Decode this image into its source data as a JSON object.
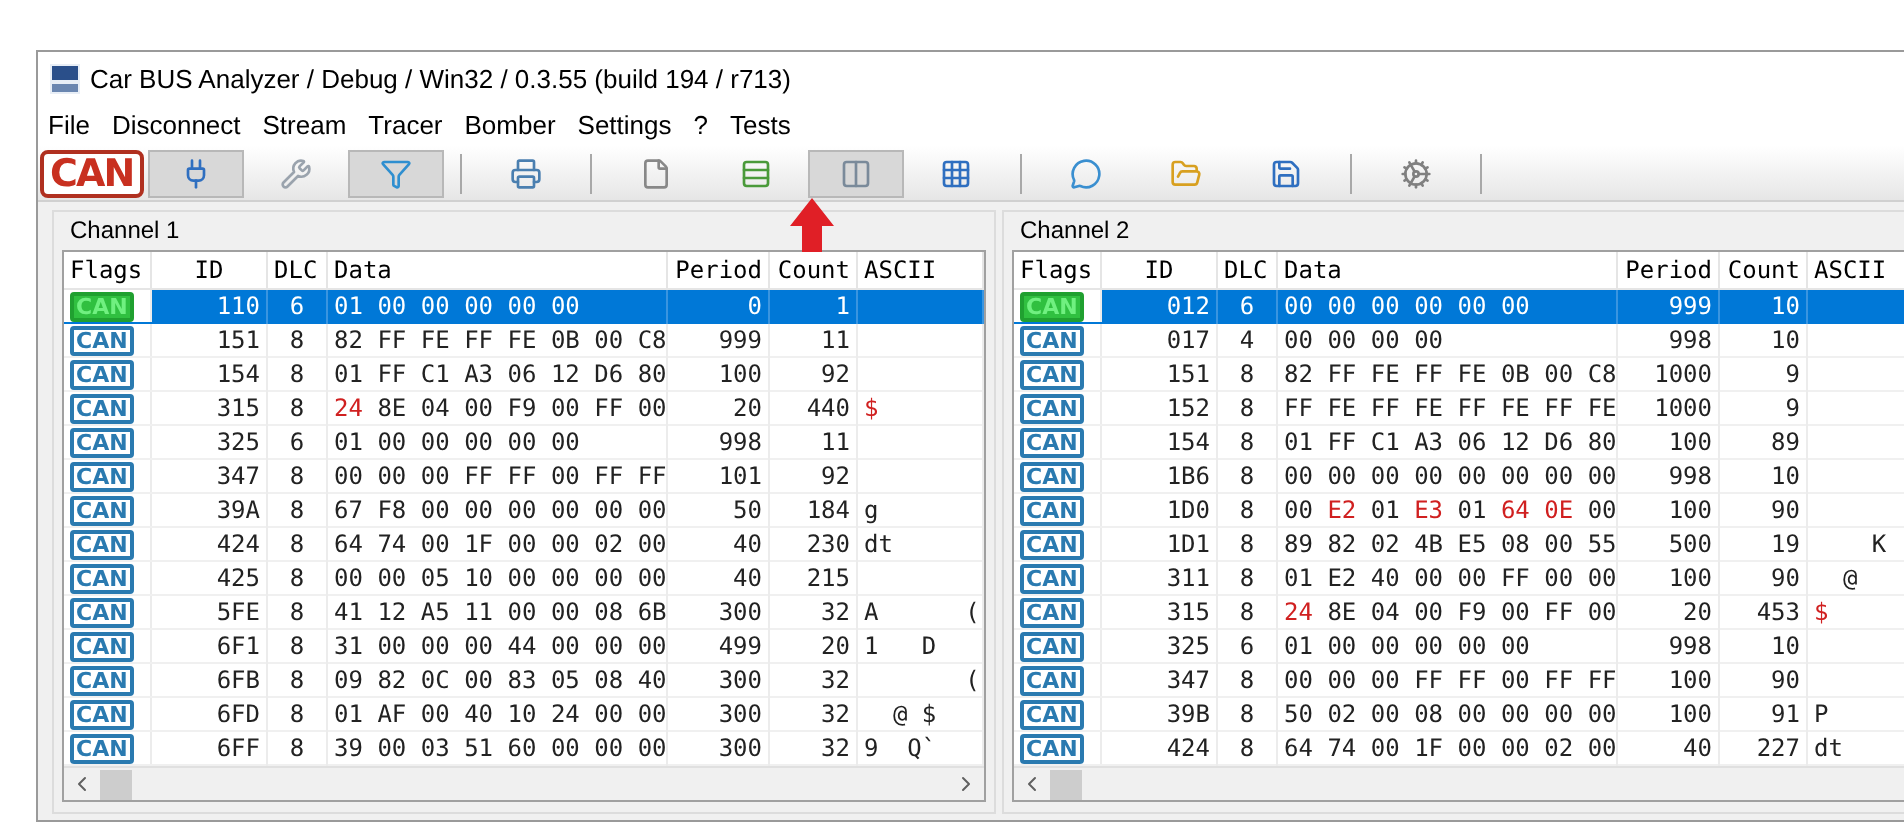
{
  "window": {
    "title": "Car BUS Analyzer / Debug / Win32 / 0.3.55 (build 194 / r713)"
  },
  "menu": [
    "File",
    "Disconnect",
    "Stream",
    "Tracer",
    "Bomber",
    "Settings",
    "?",
    "Tests"
  ],
  "toolbar": {
    "logo": "CAN",
    "items": [
      {
        "kind": "button",
        "pressed": true
      },
      {
        "kind": "button",
        "pressed": false
      },
      {
        "kind": "button",
        "pressed": true
      },
      {
        "kind": "separator"
      },
      {
        "kind": "button",
        "pressed": false
      },
      {
        "kind": "separator"
      },
      {
        "kind": "button",
        "pressed": false
      },
      {
        "kind": "button",
        "pressed": false
      },
      {
        "kind": "button",
        "pressed": true
      },
      {
        "kind": "button",
        "pressed": false
      },
      {
        "kind": "separator"
      },
      {
        "kind": "button",
        "pressed": false
      },
      {
        "kind": "button",
        "pressed": false
      },
      {
        "kind": "button",
        "pressed": false
      },
      {
        "kind": "separator"
      },
      {
        "kind": "button",
        "pressed": false
      },
      {
        "kind": "separator"
      }
    ]
  },
  "annotation": {
    "kind": "arrow"
  },
  "channels": [
    {
      "title": "Channel 1",
      "columns": [
        "Flags",
        "ID",
        "DLC",
        "Data",
        "Period",
        "Count",
        "ASCII"
      ],
      "rows": [
        {
          "flag": "CAN",
          "id": "110",
          "dlc": "6",
          "data": [
            "01",
            "00",
            "00",
            "00",
            "00",
            "00"
          ],
          "changed": [
            false,
            false,
            false,
            false,
            false,
            false
          ],
          "period": "0",
          "count": "1",
          "ascii_changed": false,
          "selected": true
        },
        {
          "flag": "CAN",
          "id": "151",
          "dlc": "8",
          "data": [
            "82",
            "FF",
            "FE",
            "FF",
            "FE",
            "0B",
            "00",
            "C8"
          ],
          "changed": [
            false,
            false,
            false,
            false,
            false,
            false,
            false,
            false
          ],
          "period": "999",
          "count": "11",
          "ascii_changed": false,
          "selected": false
        },
        {
          "flag": "CAN",
          "id": "154",
          "dlc": "8",
          "data": [
            "01",
            "FF",
            "C1",
            "A3",
            "06",
            "12",
            "D6",
            "80"
          ],
          "changed": [
            false,
            false,
            false,
            false,
            false,
            false,
            false,
            false
          ],
          "period": "100",
          "count": "92",
          "ascii_changed": false,
          "selected": false
        },
        {
          "flag": "CAN",
          "id": "315",
          "dlc": "8",
          "data": [
            "24",
            "8E",
            "04",
            "00",
            "F9",
            "00",
            "FF",
            "00"
          ],
          "changed": [
            true,
            false,
            false,
            false,
            false,
            false,
            false,
            false
          ],
          "period": "20",
          "count": "440",
          "ascii": "$",
          "ascii_changed": true,
          "selected": false
        },
        {
          "flag": "CAN",
          "id": "325",
          "dlc": "6",
          "data": [
            "01",
            "00",
            "00",
            "00",
            "00",
            "00"
          ],
          "changed": [
            false,
            false,
            false,
            false,
            false,
            false
          ],
          "period": "998",
          "count": "11",
          "ascii_changed": false,
          "selected": false
        },
        {
          "flag": "CAN",
          "id": "347",
          "dlc": "8",
          "data": [
            "00",
            "00",
            "00",
            "FF",
            "FF",
            "00",
            "FF",
            "FF"
          ],
          "changed": [
            false,
            false,
            false,
            false,
            false,
            false,
            false,
            false
          ],
          "period": "101",
          "count": "92",
          "ascii_changed": false,
          "selected": false
        },
        {
          "flag": "CAN",
          "id": "39A",
          "dlc": "8",
          "data": [
            "67",
            "F8",
            "00",
            "00",
            "00",
            "00",
            "00",
            "00"
          ],
          "changed": [
            false,
            false,
            false,
            false,
            false,
            false,
            false,
            false
          ],
          "period": "50",
          "count": "184",
          "ascii": "g",
          "ascii_changed": false,
          "selected": false
        },
        {
          "flag": "CAN",
          "id": "424",
          "dlc": "8",
          "data": [
            "64",
            "74",
            "00",
            "1F",
            "00",
            "00",
            "02",
            "00"
          ],
          "changed": [
            false,
            false,
            false,
            false,
            false,
            false,
            false,
            false
          ],
          "period": "40",
          "count": "230",
          "ascii": "dt",
          "ascii_changed": false,
          "selected": false
        },
        {
          "flag": "CAN",
          "id": "425",
          "dlc": "8",
          "data": [
            "00",
            "00",
            "05",
            "10",
            "00",
            "00",
            "00",
            "00"
          ],
          "changed": [
            false,
            false,
            false,
            false,
            false,
            false,
            false,
            false
          ],
          "period": "40",
          "count": "215",
          "ascii_changed": false,
          "selected": false
        },
        {
          "flag": "CAN",
          "id": "5FE",
          "dlc": "8",
          "data": [
            "41",
            "12",
            "A5",
            "11",
            "00",
            "00",
            "08",
            "6B"
          ],
          "changed": [
            false,
            false,
            false,
            false,
            false,
            false,
            false,
            false
          ],
          "period": "300",
          "count": "32",
          "ascii": "A      (",
          "ascii_changed": false,
          "selected": false
        },
        {
          "flag": "CAN",
          "id": "6F1",
          "dlc": "8",
          "data": [
            "31",
            "00",
            "00",
            "00",
            "44",
            "00",
            "00",
            "00"
          ],
          "changed": [
            false,
            false,
            false,
            false,
            false,
            false,
            false,
            false
          ],
          "period": "499",
          "count": "20",
          "ascii": "1   D",
          "ascii_changed": false,
          "selected": false
        },
        {
          "flag": "CAN",
          "id": "6FB",
          "dlc": "8",
          "data": [
            "09",
            "82",
            "0C",
            "00",
            "83",
            "05",
            "08",
            "40"
          ],
          "changed": [
            false,
            false,
            false,
            false,
            false,
            false,
            false,
            false
          ],
          "period": "300",
          "count": "32",
          "ascii": "       (",
          "ascii_changed": false,
          "selected": false
        },
        {
          "flag": "CAN",
          "id": "6FD",
          "dlc": "8",
          "data": [
            "01",
            "AF",
            "00",
            "40",
            "10",
            "24",
            "00",
            "00"
          ],
          "changed": [
            false,
            false,
            false,
            false,
            false,
            false,
            false,
            false
          ],
          "period": "300",
          "count": "32",
          "ascii": "  @ $",
          "ascii_changed": false,
          "selected": false
        },
        {
          "flag": "CAN",
          "id": "6FF",
          "dlc": "8",
          "data": [
            "39",
            "00",
            "03",
            "51",
            "60",
            "00",
            "00",
            "00"
          ],
          "changed": [
            false,
            false,
            false,
            false,
            false,
            false,
            false,
            false
          ],
          "period": "300",
          "count": "32",
          "ascii": "9  Q`",
          "ascii_changed": false,
          "selected": false
        }
      ]
    },
    {
      "title": "Channel 2",
      "columns": [
        "Flags",
        "ID",
        "DLC",
        "Data",
        "Period",
        "Count",
        "ASCII"
      ],
      "rows": [
        {
          "flag": "CAN",
          "id": "012",
          "dlc": "6",
          "data": [
            "00",
            "00",
            "00",
            "00",
            "00",
            "00"
          ],
          "changed": [
            false,
            false,
            false,
            false,
            false,
            false
          ],
          "period": "999",
          "count": "10",
          "ascii_changed": false,
          "selected": true
        },
        {
          "flag": "CAN",
          "id": "017",
          "dlc": "4",
          "data": [
            "00",
            "00",
            "00",
            "00"
          ],
          "changed": [
            false,
            false,
            false,
            false
          ],
          "period": "998",
          "count": "10",
          "ascii_changed": false,
          "selected": false
        },
        {
          "flag": "CAN",
          "id": "151",
          "dlc": "8",
          "data": [
            "82",
            "FF",
            "FE",
            "FF",
            "FE",
            "0B",
            "00",
            "C8"
          ],
          "changed": [
            false,
            false,
            false,
            false,
            false,
            false,
            false,
            false
          ],
          "period": "1000",
          "count": "9",
          "ascii_changed": false,
          "selected": false
        },
        {
          "flag": "CAN",
          "id": "152",
          "dlc": "8",
          "data": [
            "FF",
            "FE",
            "FF",
            "FE",
            "FF",
            "FE",
            "FF",
            "FE"
          ],
          "changed": [
            false,
            false,
            false,
            false,
            false,
            false,
            false,
            false
          ],
          "period": "1000",
          "count": "9",
          "ascii_changed": false,
          "selected": false
        },
        {
          "flag": "CAN",
          "id": "154",
          "dlc": "8",
          "data": [
            "01",
            "FF",
            "C1",
            "A3",
            "06",
            "12",
            "D6",
            "80"
          ],
          "changed": [
            false,
            false,
            false,
            false,
            false,
            false,
            false,
            false
          ],
          "period": "100",
          "count": "89",
          "ascii_changed": false,
          "selected": false
        },
        {
          "flag": "CAN",
          "id": "1B6",
          "dlc": "8",
          "data": [
            "00",
            "00",
            "00",
            "00",
            "00",
            "00",
            "00",
            "00"
          ],
          "changed": [
            false,
            false,
            false,
            false,
            false,
            false,
            false,
            false
          ],
          "period": "998",
          "count": "10",
          "ascii_changed": false,
          "selected": false
        },
        {
          "flag": "CAN",
          "id": "1D0",
          "dlc": "8",
          "data": [
            "00",
            "E2",
            "01",
            "E3",
            "01",
            "64",
            "0E",
            "00"
          ],
          "changed": [
            false,
            true,
            false,
            true,
            false,
            true,
            true,
            false
          ],
          "period": "100",
          "count": "90",
          "ascii_changed": false,
          "selected": false
        },
        {
          "flag": "CAN",
          "id": "1D1",
          "dlc": "8",
          "data": [
            "89",
            "82",
            "02",
            "4B",
            "E5",
            "08",
            "00",
            "55"
          ],
          "changed": [
            false,
            false,
            false,
            false,
            false,
            false,
            false,
            false
          ],
          "period": "500",
          "count": "19",
          "ascii": "    K",
          "ascii_changed": false,
          "selected": false
        },
        {
          "flag": "CAN",
          "id": "311",
          "dlc": "8",
          "data": [
            "01",
            "E2",
            "40",
            "00",
            "00",
            "FF",
            "00",
            "00"
          ],
          "changed": [
            false,
            false,
            false,
            false,
            false,
            false,
            false,
            false
          ],
          "period": "100",
          "count": "90",
          "ascii": "  @",
          "ascii_changed": false,
          "selected": false
        },
        {
          "flag": "CAN",
          "id": "315",
          "dlc": "8",
          "data": [
            "24",
            "8E",
            "04",
            "00",
            "F9",
            "00",
            "FF",
            "00"
          ],
          "changed": [
            true,
            false,
            false,
            false,
            false,
            false,
            false,
            false
          ],
          "period": "20",
          "count": "453",
          "ascii": "$",
          "ascii_changed": true,
          "selected": false
        },
        {
          "flag": "CAN",
          "id": "325",
          "dlc": "6",
          "data": [
            "01",
            "00",
            "00",
            "00",
            "00",
            "00"
          ],
          "changed": [
            false,
            false,
            false,
            false,
            false,
            false
          ],
          "period": "998",
          "count": "10",
          "ascii_changed": false,
          "selected": false
        },
        {
          "flag": "CAN",
          "id": "347",
          "dlc": "8",
          "data": [
            "00",
            "00",
            "00",
            "FF",
            "FF",
            "00",
            "FF",
            "FF"
          ],
          "changed": [
            false,
            false,
            false,
            false,
            false,
            false,
            false,
            false
          ],
          "period": "100",
          "count": "90",
          "ascii_changed": false,
          "selected": false
        },
        {
          "flag": "CAN",
          "id": "39B",
          "dlc": "8",
          "data": [
            "50",
            "02",
            "00",
            "08",
            "00",
            "00",
            "00",
            "00"
          ],
          "changed": [
            false,
            false,
            false,
            false,
            false,
            false,
            false,
            false
          ],
          "period": "100",
          "count": "91",
          "ascii": "P",
          "ascii_changed": false,
          "selected": false
        },
        {
          "flag": "CAN",
          "id": "424",
          "dlc": "8",
          "data": [
            "64",
            "74",
            "00",
            "1F",
            "00",
            "00",
            "02",
            "00"
          ],
          "changed": [
            false,
            false,
            false,
            false,
            false,
            false,
            false,
            false
          ],
          "period": "40",
          "count": "227",
          "ascii": "dt",
          "ascii_changed": false,
          "selected": false
        }
      ]
    }
  ]
}
